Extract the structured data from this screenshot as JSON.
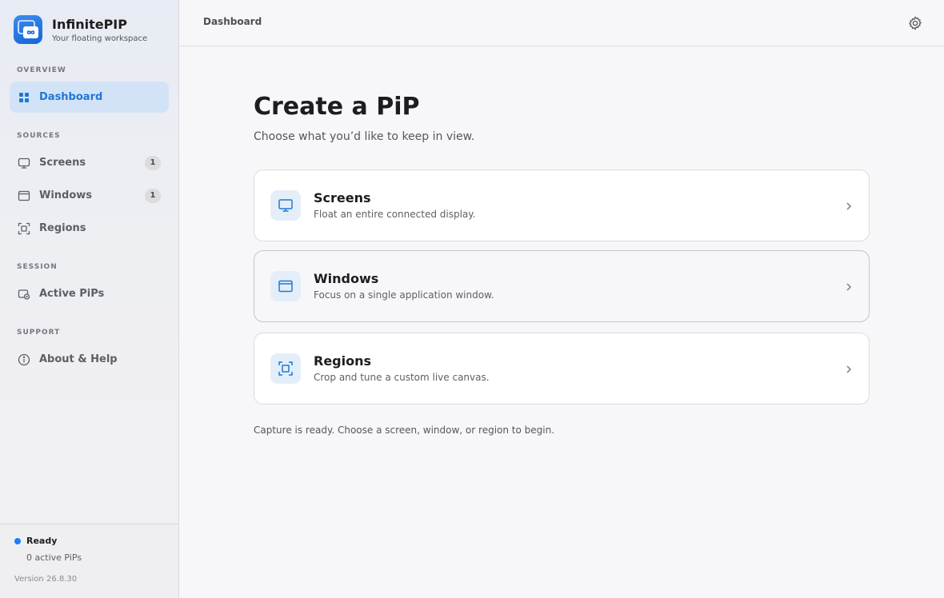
{
  "app": {
    "name": "InfinitePIP",
    "tagline": "Your floating workspace"
  },
  "sidebar": {
    "sections": {
      "overview": "OVERVIEW",
      "sources": "SOURCES",
      "session": "SESSION",
      "support": "SUPPORT"
    },
    "items": [
      {
        "label": "Dashboard",
        "icon": "grid-icon",
        "active": true
      },
      {
        "label": "Screens",
        "icon": "monitor-icon",
        "badge": "1"
      },
      {
        "label": "Windows",
        "icon": "window-icon",
        "badge": "1"
      },
      {
        "label": "Regions",
        "icon": "region-icon"
      },
      {
        "label": "Active PiPs",
        "icon": "pip-icon"
      },
      {
        "label": "About & Help",
        "icon": "info-icon"
      }
    ],
    "footer": {
      "status": "Ready",
      "active_count": "0 active PiPs",
      "version": "Version 26.8.30"
    }
  },
  "topbar": {
    "breadcrumb": "Dashboard",
    "settings_icon": "gear-icon"
  },
  "main": {
    "title": "Create a PiP",
    "subtitle": "Choose what you’d like to keep in view.",
    "cards": [
      {
        "title": "Screens",
        "desc": "Float an entire connected display.",
        "icon": "monitor-icon"
      },
      {
        "title": "Windows",
        "desc": "Focus on a single application window.",
        "icon": "window-icon"
      },
      {
        "title": "Regions",
        "desc": "Crop and tune a custom live canvas.",
        "icon": "region-icon"
      }
    ],
    "footnote": "Capture is ready. Choose a screen, window, or region to begin."
  },
  "colors": {
    "accent": "#1f78d6",
    "status_ready": "#1a7ff0"
  }
}
